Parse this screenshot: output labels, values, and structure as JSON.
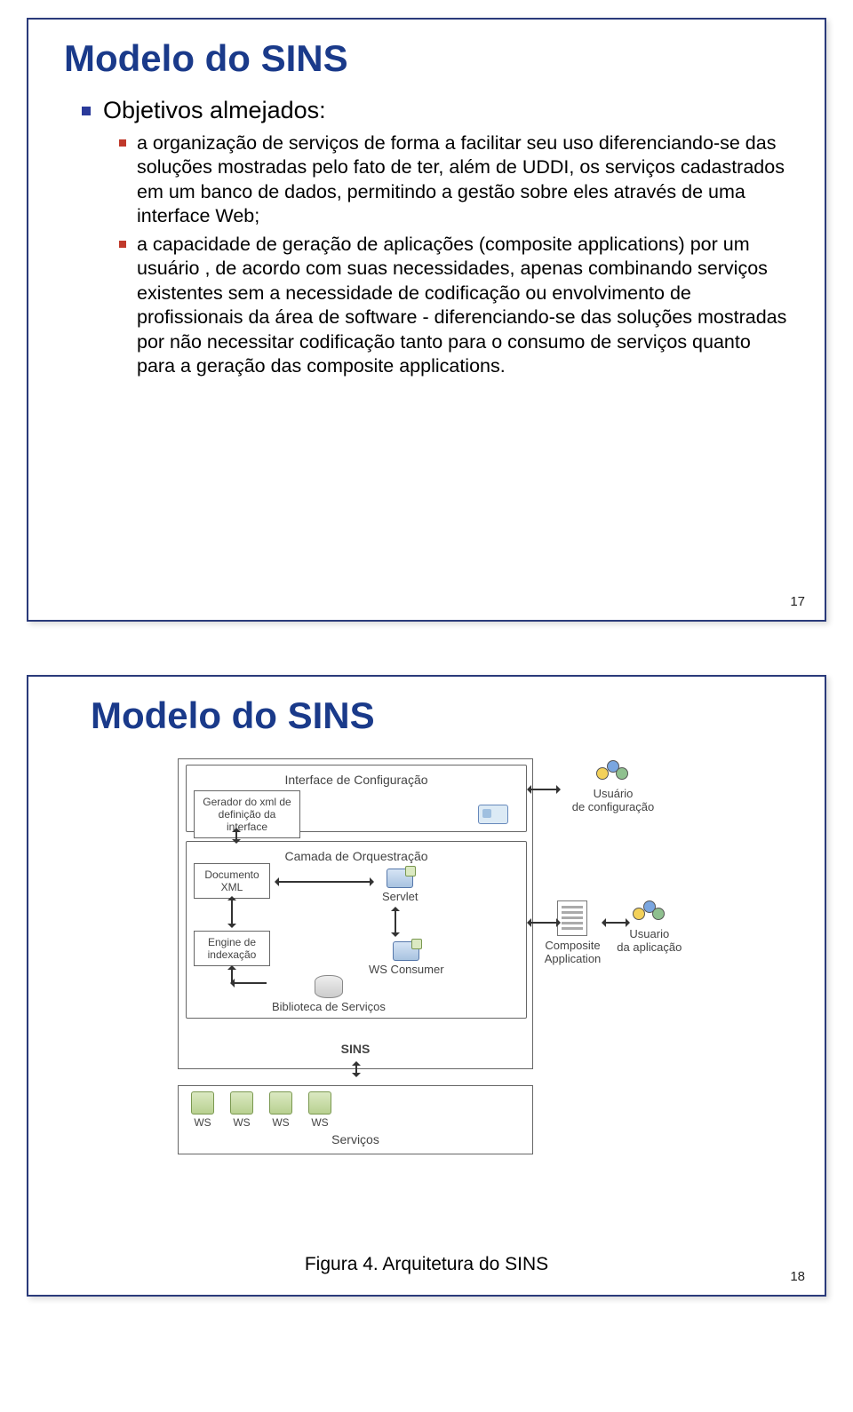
{
  "slide17": {
    "title": "Modelo do SINS",
    "bullet1": "Objetivos almejados:",
    "sub1": "a organização de serviços de forma a facilitar seu uso diferenciando-se das soluções mostradas pelo fato de ter, além de UDDI, os serviços cadastrados em um banco de dados, permitindo a gestão sobre eles através de uma interface Web;",
    "sub2": "a capacidade de geração de aplicações (composite applications) por um usuário , de acordo com suas necessidades, apenas combinando serviços existentes sem a necessidade de codificação ou envolvimento de profissionais da área de software  - diferenciando-se das soluções mostradas por não necessitar codificação tanto para o consumo de serviços quanto para a geração das composite applications.",
    "pagenum": "17"
  },
  "slide18": {
    "title": "Modelo do SINS",
    "caption": "Figura 4. Arquitetura do SINS",
    "pagenum": "18",
    "diagram": {
      "sins_label": "SINS",
      "layer_config": "Interface de Configuração",
      "gerador_xml": "Gerador do xml de definição da interface",
      "layer_orq": "Camada de Orquestração",
      "doc_xml": "Documento\nXML",
      "servlet": "Servlet",
      "engine_idx": "Engine de indexação",
      "ws_consumer": "WS Consumer",
      "biblioteca": "Biblioteca de Serviços",
      "usuario_config": "Usuário\nde configuração",
      "composite_app": "Composite\nApplication",
      "usuario_app": "Usuario\nda aplicação",
      "servicos_label": "Serviços",
      "ws": "WS"
    }
  }
}
